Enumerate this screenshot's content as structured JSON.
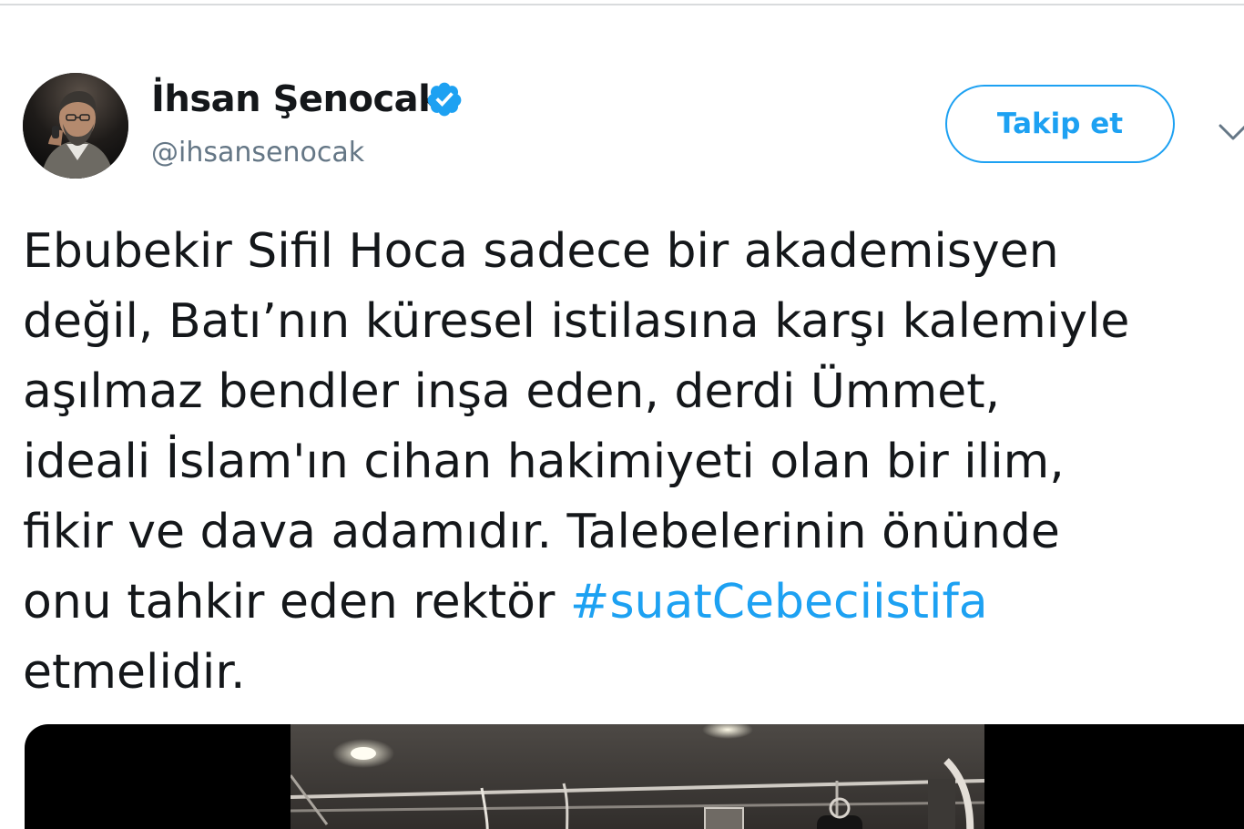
{
  "user": {
    "display_name": "İhsan Şenocak",
    "handle": "@ihsansenocak",
    "verified": true
  },
  "follow_button": {
    "label": "Takip et"
  },
  "tweet": {
    "lines": [
      "Ebubekir Sifil Hoca sadece bir akademisyen",
      "değil, Batı’nın küresel istilasına karşı kalemiyle",
      "aşılmaz bendler inşa eden, derdi Ümmet,",
      "ideali İslam'ın cihan hakimiyeti olan bir ilim,",
      "fikir ve dava adamıdır. Talebelerinin önünde"
    ],
    "line6_prefix": "onu tahkir eden rektör ",
    "hashtag": "#suatCebeciistifa",
    "line7": "etmelidir."
  },
  "icons": {
    "verified": "verified-badge-icon",
    "caret": "chevron-down-icon"
  },
  "colors": {
    "accent": "#1da1f2",
    "text": "#14171a",
    "muted": "#657786"
  }
}
